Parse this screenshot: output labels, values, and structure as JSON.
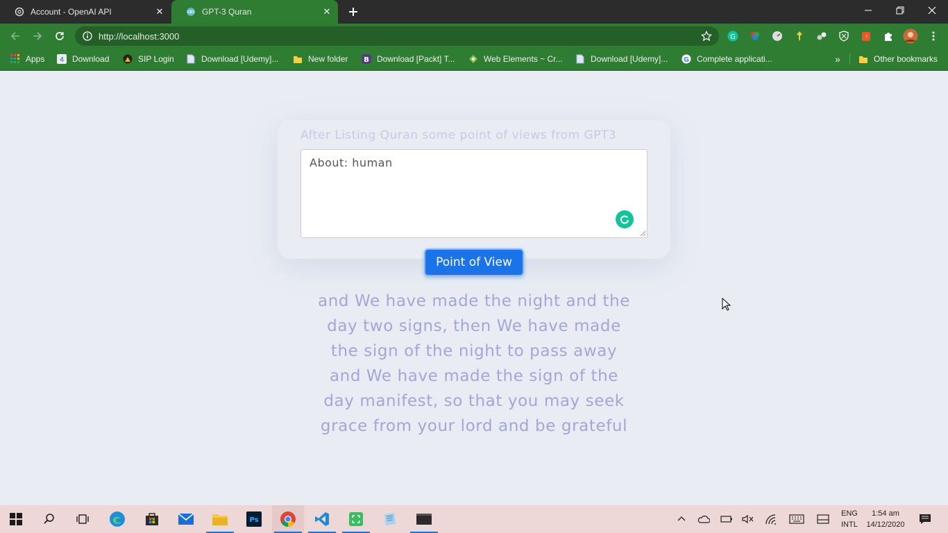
{
  "browser": {
    "tabs": [
      {
        "title": "Account - OpenAI API",
        "active": false
      },
      {
        "title": "GPT-3 Quran",
        "active": true
      }
    ],
    "address_bar": {
      "url": "http://localhost:3000"
    },
    "bookmarks": [
      {
        "label": "Apps",
        "icon": "apps-grid-icon"
      },
      {
        "label": "Download",
        "icon": "download-site-icon"
      },
      {
        "label": "SIP Login",
        "icon": "sip-login-icon"
      },
      {
        "label": "Download [Udemy]...",
        "icon": "page-icon"
      },
      {
        "label": "New folder",
        "icon": "folder-icon"
      },
      {
        "label": "Download [Packt] T...",
        "icon": "bootstrap-icon"
      },
      {
        "label": "Web Elements ~ Cr...",
        "icon": "web-elements-icon"
      },
      {
        "label": "Download [Udemy]...",
        "icon": "page-icon"
      },
      {
        "label": "Complete applicati...",
        "icon": "google-icon"
      }
    ],
    "overflow_label": "»",
    "other_bookmarks": "Other bookmarks"
  },
  "page": {
    "heading": "After Listing Quran some point of views from GPT3",
    "input_value": "About: human",
    "button_label": "Point of View",
    "answer": "and We have made the night and the day two signs, then We have made the sign of the night to pass away and We have made the sign of the day manifest, so that you may seek grace from your lord and be grateful"
  },
  "taskbar": {
    "language": [
      "ENG",
      "INTL"
    ],
    "time": "1:54 am",
    "date": "14/12/2020"
  },
  "colors": {
    "chrome_green": "#2e7d32",
    "page_bg": "#e9edf3",
    "button_blue": "#1a73e8",
    "answer_text": "#a3a6d8",
    "taskbar_bg": "#eed7d7"
  }
}
